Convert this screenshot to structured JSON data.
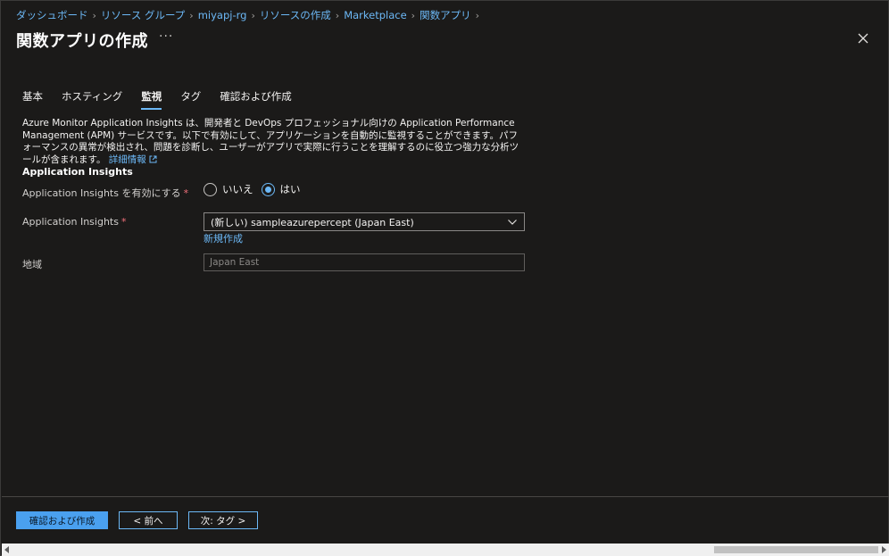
{
  "breadcrumb": [
    "ダッシュボード",
    "リソース グループ",
    "miyapj-rg",
    "リソースの作成",
    "Marketplace",
    "関数アプリ"
  ],
  "page_title": "関数アプリの作成",
  "more_label": "···",
  "tabs": [
    {
      "label": "基本",
      "active": false
    },
    {
      "label": "ホスティング",
      "active": false
    },
    {
      "label": "監視",
      "active": true
    },
    {
      "label": "タグ",
      "active": false
    },
    {
      "label": "確認および作成",
      "active": false
    }
  ],
  "description": {
    "text": "Azure Monitor Application Insights は、開発者と DevOps プロフェッショナル向けの Application Performance Management (APM) サービスです。以下で有効にして、アプリケーションを自動的に監視することができます。パフォーマンスの異常が検出され、問題を診断し、ユーザーがアプリで実際に行うことを理解するのに役立つ強力な分析ツールが含まれます。",
    "link": "詳細情報"
  },
  "section_title": "Application Insights",
  "fields": {
    "enable": {
      "label": "Application Insights を有効にする",
      "required": "*",
      "options": [
        "いいえ",
        "はい"
      ],
      "selected": "はい"
    },
    "insights": {
      "label": "Application Insights",
      "required": "*",
      "value": "(新しい) sampleazurepercept (Japan East)",
      "create_new": "新規作成"
    },
    "region": {
      "label": "地域",
      "value": "Japan East"
    }
  },
  "footer": {
    "review_create": "確認および作成",
    "prev": "< 前へ",
    "next": "次: タグ >"
  },
  "colors": {
    "background": "#1b1a19",
    "accent": "#6cb8f6",
    "primary_button": "#4aa0ef",
    "required": "#f1707b"
  }
}
